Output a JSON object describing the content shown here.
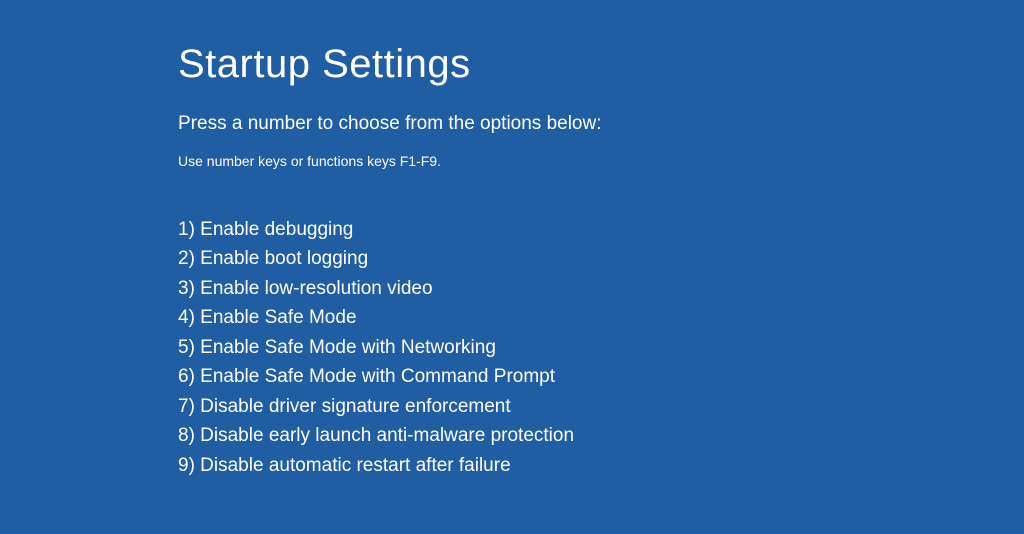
{
  "title": "Startup Settings",
  "instruction": "Press a number to choose from the options below:",
  "subinstruction": "Use number keys or functions keys F1-F9.",
  "options": [
    "1) Enable debugging",
    "2) Enable boot logging",
    "3) Enable low-resolution video",
    "4) Enable Safe Mode",
    "5) Enable Safe Mode with Networking",
    "6) Enable Safe Mode with Command Prompt",
    "7) Disable driver signature enforcement",
    "8) Disable early launch anti-malware protection",
    "9) Disable automatic restart after failure"
  ]
}
